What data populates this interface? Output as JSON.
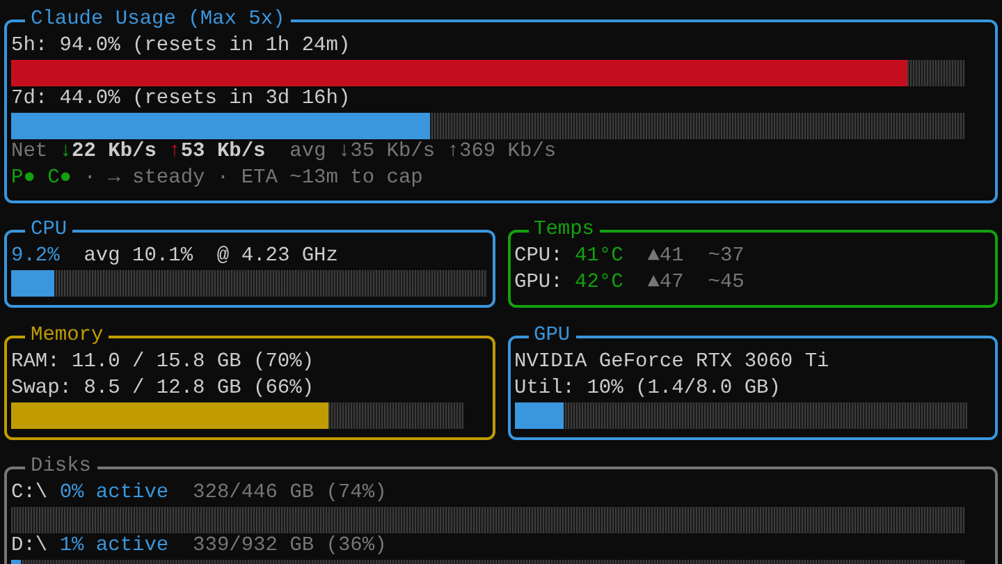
{
  "usage": {
    "title": "Claude Usage (Max 5x)",
    "limits": [
      {
        "label": "5h: 94.0% (resets in 1h 24m)",
        "level": 0.94,
        "kind": "critical"
      },
      {
        "label": "7d: 44.0% (resets in 3d 16h)",
        "level": 0.44,
        "kind": "normal"
      }
    ],
    "net": {
      "label": "Net",
      "down": {
        "arrow": "↓",
        "value": "22 Kb/s"
      },
      "up": {
        "arrow": "↑",
        "value": "53 Kb/s"
      },
      "avg": "avg ↓35 Kb/s ↑369 Kb/s"
    },
    "indicators": [
      {
        "text": "P●",
        "on": true
      },
      {
        "text": "C●",
        "on": true
      }
    ],
    "trend": "· → steady · ETA ~13m to cap"
  },
  "cpu": {
    "title": "CPU",
    "percent": "9.2%",
    "details": "avg 10.1%  @ 4.23 GHz",
    "level": 0.092
  },
  "temps": {
    "title": "Temps",
    "rows": [
      {
        "label": "CPU:",
        "value": "41°C",
        "max": "▲41",
        "avg": "~37"
      },
      {
        "label": "GPU:",
        "value": "42°C",
        "max": "▲47",
        "avg": "~45"
      }
    ]
  },
  "memory": {
    "title": "Memory",
    "lines": [
      "RAM: 11.0 / 15.8 GB (70%)",
      "Swap: 8.5 / 12.8 GB (66%)"
    ],
    "level": 0.7
  },
  "gpu": {
    "title": "GPU",
    "name": "NVIDIA GeForce RTX 3060 Ti",
    "util": "Util: 10% (1.4/8.0 GB)",
    "level": 0.11
  },
  "disks": {
    "title": "Disks",
    "rows": [
      {
        "name": "C:\\",
        "active": "0% active",
        "usage": "328/446 GB (74%)",
        "level": 0
      },
      {
        "name": "D:\\",
        "active": "1% active",
        "usage": "339/932 GB (36%)",
        "level": 0.01
      }
    ]
  }
}
